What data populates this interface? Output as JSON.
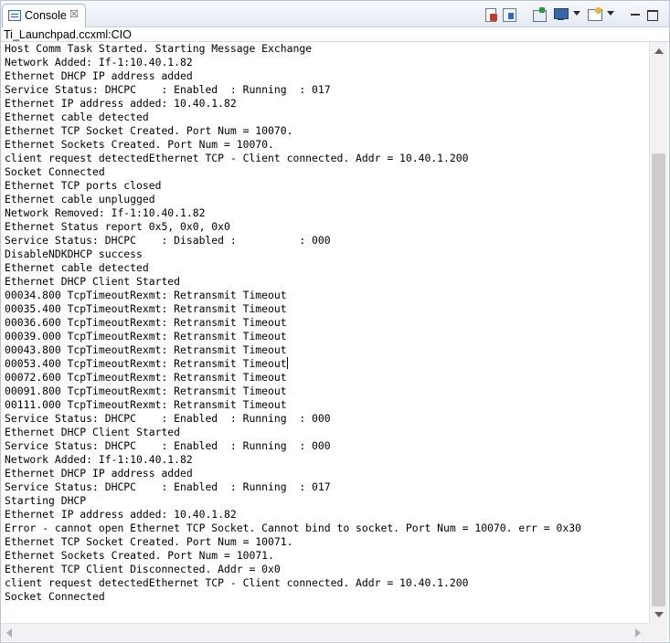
{
  "tab": {
    "label": "Console",
    "close_glyph": "☒"
  },
  "console": {
    "title": "Ti_Launchpad.ccxml:CIO"
  },
  "toolbar": [
    {
      "name": "clear-console-icon"
    },
    {
      "name": "scroll-lock-icon"
    },
    {
      "name": "pin-console-icon"
    },
    {
      "name": "display-selected-console-icon"
    },
    {
      "name": "open-console-icon"
    },
    {
      "name": "minimize-icon"
    },
    {
      "name": "maximize-icon"
    }
  ],
  "log_lines": [
    "Host Comm Task Started. Starting Message Exchange",
    "Network Added: If-1:10.40.1.82",
    "Ethernet DHCP IP address added",
    "Service Status: DHCPC    : Enabled  : Running  : 017",
    "Ethernet IP address added: 10.40.1.82",
    "Ethernet cable detected",
    "Ethernet TCP Socket Created. Port Num = 10070.",
    "Ethernet Sockets Created. Port Num = 10070.",
    "client request detectedEthernet TCP - Client connected. Addr = 10.40.1.200",
    "Socket Connected",
    "Ethernet TCP ports closed",
    "Ethernet cable unplugged",
    "Network Removed: If-1:10.40.1.82",
    "Ethernet Status report 0x5, 0x0, 0x0",
    "Service Status: DHCPC    : Disabled :          : 000",
    "DisableNDKDHCP success",
    "Ethernet cable detected",
    "Ethernet DHCP Client Started",
    "00034.800 TcpTimeoutRexmt: Retransmit Timeout",
    "00035.400 TcpTimeoutRexmt: Retransmit Timeout",
    "00036.600 TcpTimeoutRexmt: Retransmit Timeout",
    "00039.000 TcpTimeoutRexmt: Retransmit Timeout",
    "00043.800 TcpTimeoutRexmt: Retransmit Timeout",
    "00053.400 TcpTimeoutRexmt: Retransmit Timeout",
    "00072.600 TcpTimeoutRexmt: Retransmit Timeout",
    "00091.800 TcpTimeoutRexmt: Retransmit Timeout",
    "00111.000 TcpTimeoutRexmt: Retransmit Timeout",
    "Service Status: DHCPC    : Enabled  : Running  : 000",
    "Ethernet DHCP Client Started",
    "Service Status: DHCPC    : Enabled  : Running  : 000",
    "Network Added: If-1:10.40.1.82",
    "Ethernet DHCP IP address added",
    "Service Status: DHCPC    : Enabled  : Running  : 017",
    "Starting DHCP",
    "Ethernet IP address added: 10.40.1.82",
    "Error - cannot open Ethernet TCP Socket. Cannot bind to socket. Port Num = 10070. err = 0x30",
    "Ethernet TCP Socket Created. Port Num = 10071.",
    "Ethernet Sockets Created. Port Num = 10071.",
    "Etherent TCP Client Disconnected. Addr = 0x0",
    "client request detectedEthernet TCP - Client connected. Addr = 10.40.1.200",
    "Socket Connected"
  ]
}
